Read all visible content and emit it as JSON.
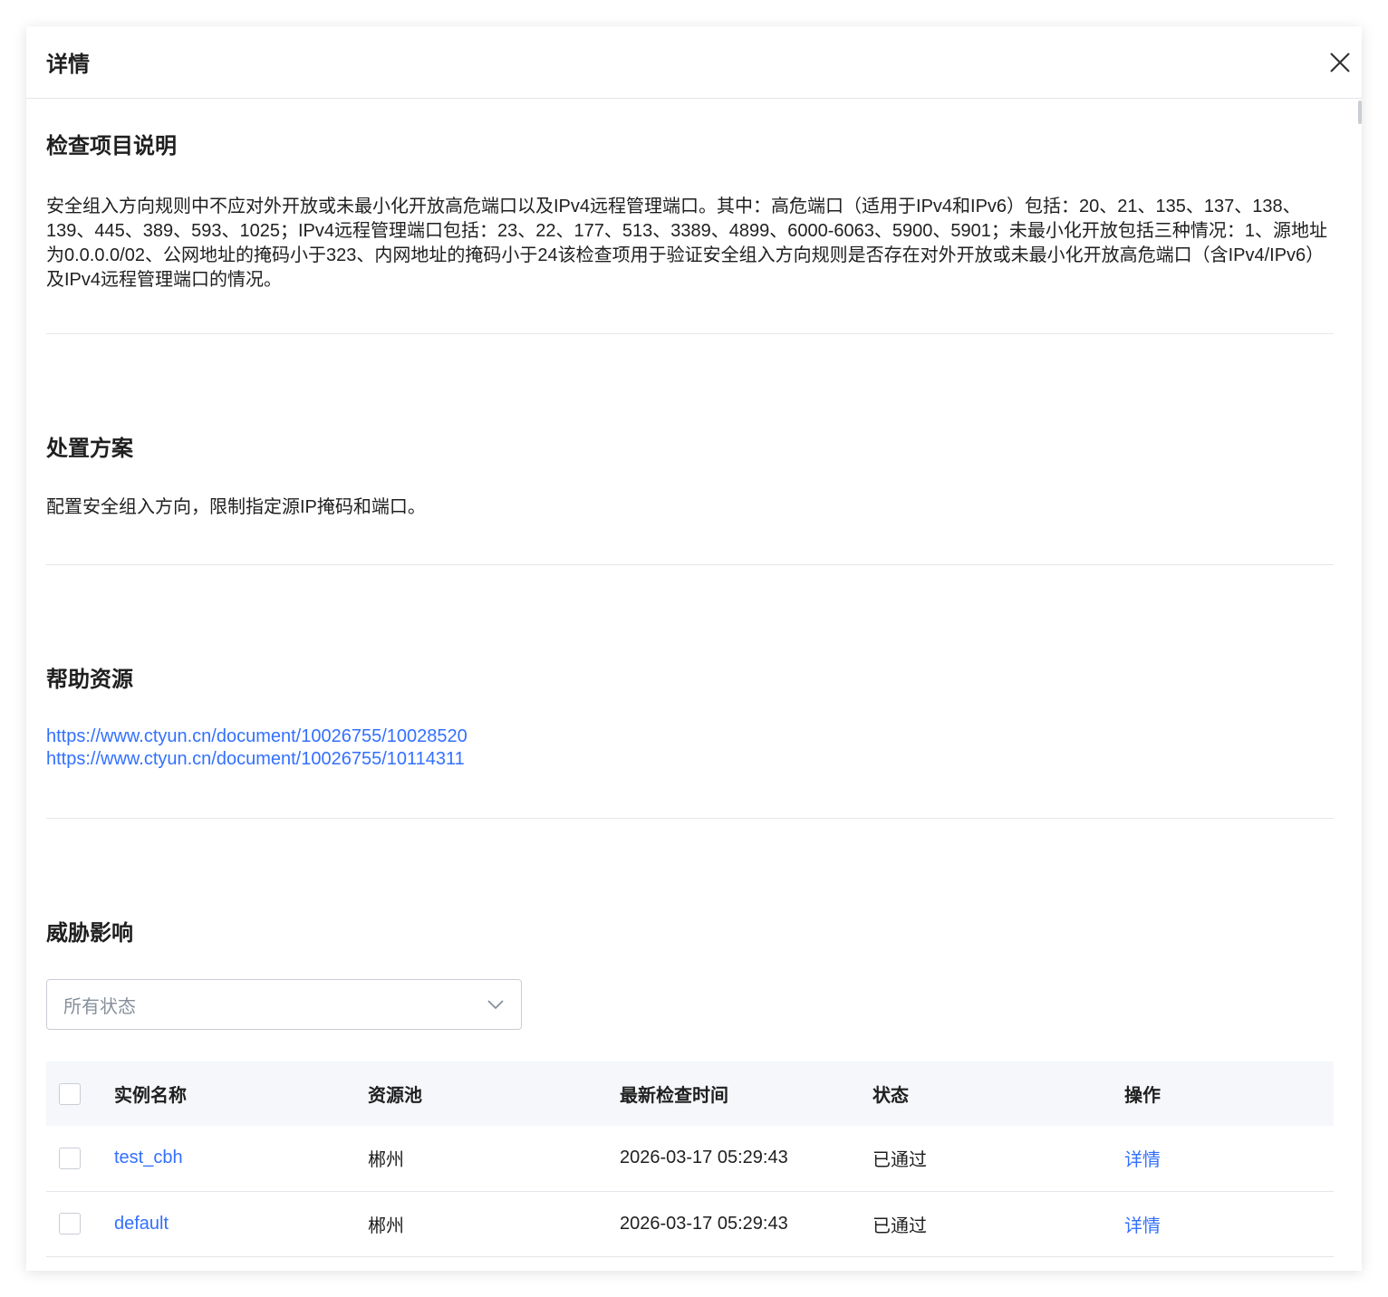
{
  "dialog": {
    "title": "详情"
  },
  "check": {
    "heading": "检查项目说明",
    "text": "安全组入方向规则中不应对外开放或未最小化开放高危端口以及IPv4远程管理端口。其中：高危端口（适用于IPv4和IPv6）包括：20、21、135、137、138、139、445、389、593、1025；IPv4远程管理端口包括：23、22、177、513、3389、4899、6000-6063、5900、5901；未最小化开放包括三种情况：1、源地址为0.0.0.0/02、公网地址的掩码小于323、内网地址的掩码小于24该检查项用于验证安全组入方向规则是否存在对外开放或未最小化开放高危端口（含IPv4/IPv6）及IPv4远程管理端口的情况。"
  },
  "solution": {
    "heading": "处置方案",
    "text": "配置安全组入方向，限制指定源IP掩码和端口。"
  },
  "help": {
    "heading": "帮助资源",
    "links": [
      "https://www.ctyun.cn/document/10026755/10028520",
      "https://www.ctyun.cn/document/10026755/10114311"
    ]
  },
  "impact": {
    "heading": "威胁影响",
    "filter": "所有状态",
    "columns": [
      "实例名称",
      "资源池",
      "最新检查时间",
      "状态",
      "操作"
    ],
    "rows": [
      {
        "name": "test_cbh",
        "pool": "郴州",
        "time": "2026-03-17 05:29:43",
        "status": "已通过",
        "action": "详情"
      },
      {
        "name": "default",
        "pool": "郴州",
        "time": "2026-03-17 05:29:43",
        "status": "已通过",
        "action": "详情"
      }
    ]
  }
}
